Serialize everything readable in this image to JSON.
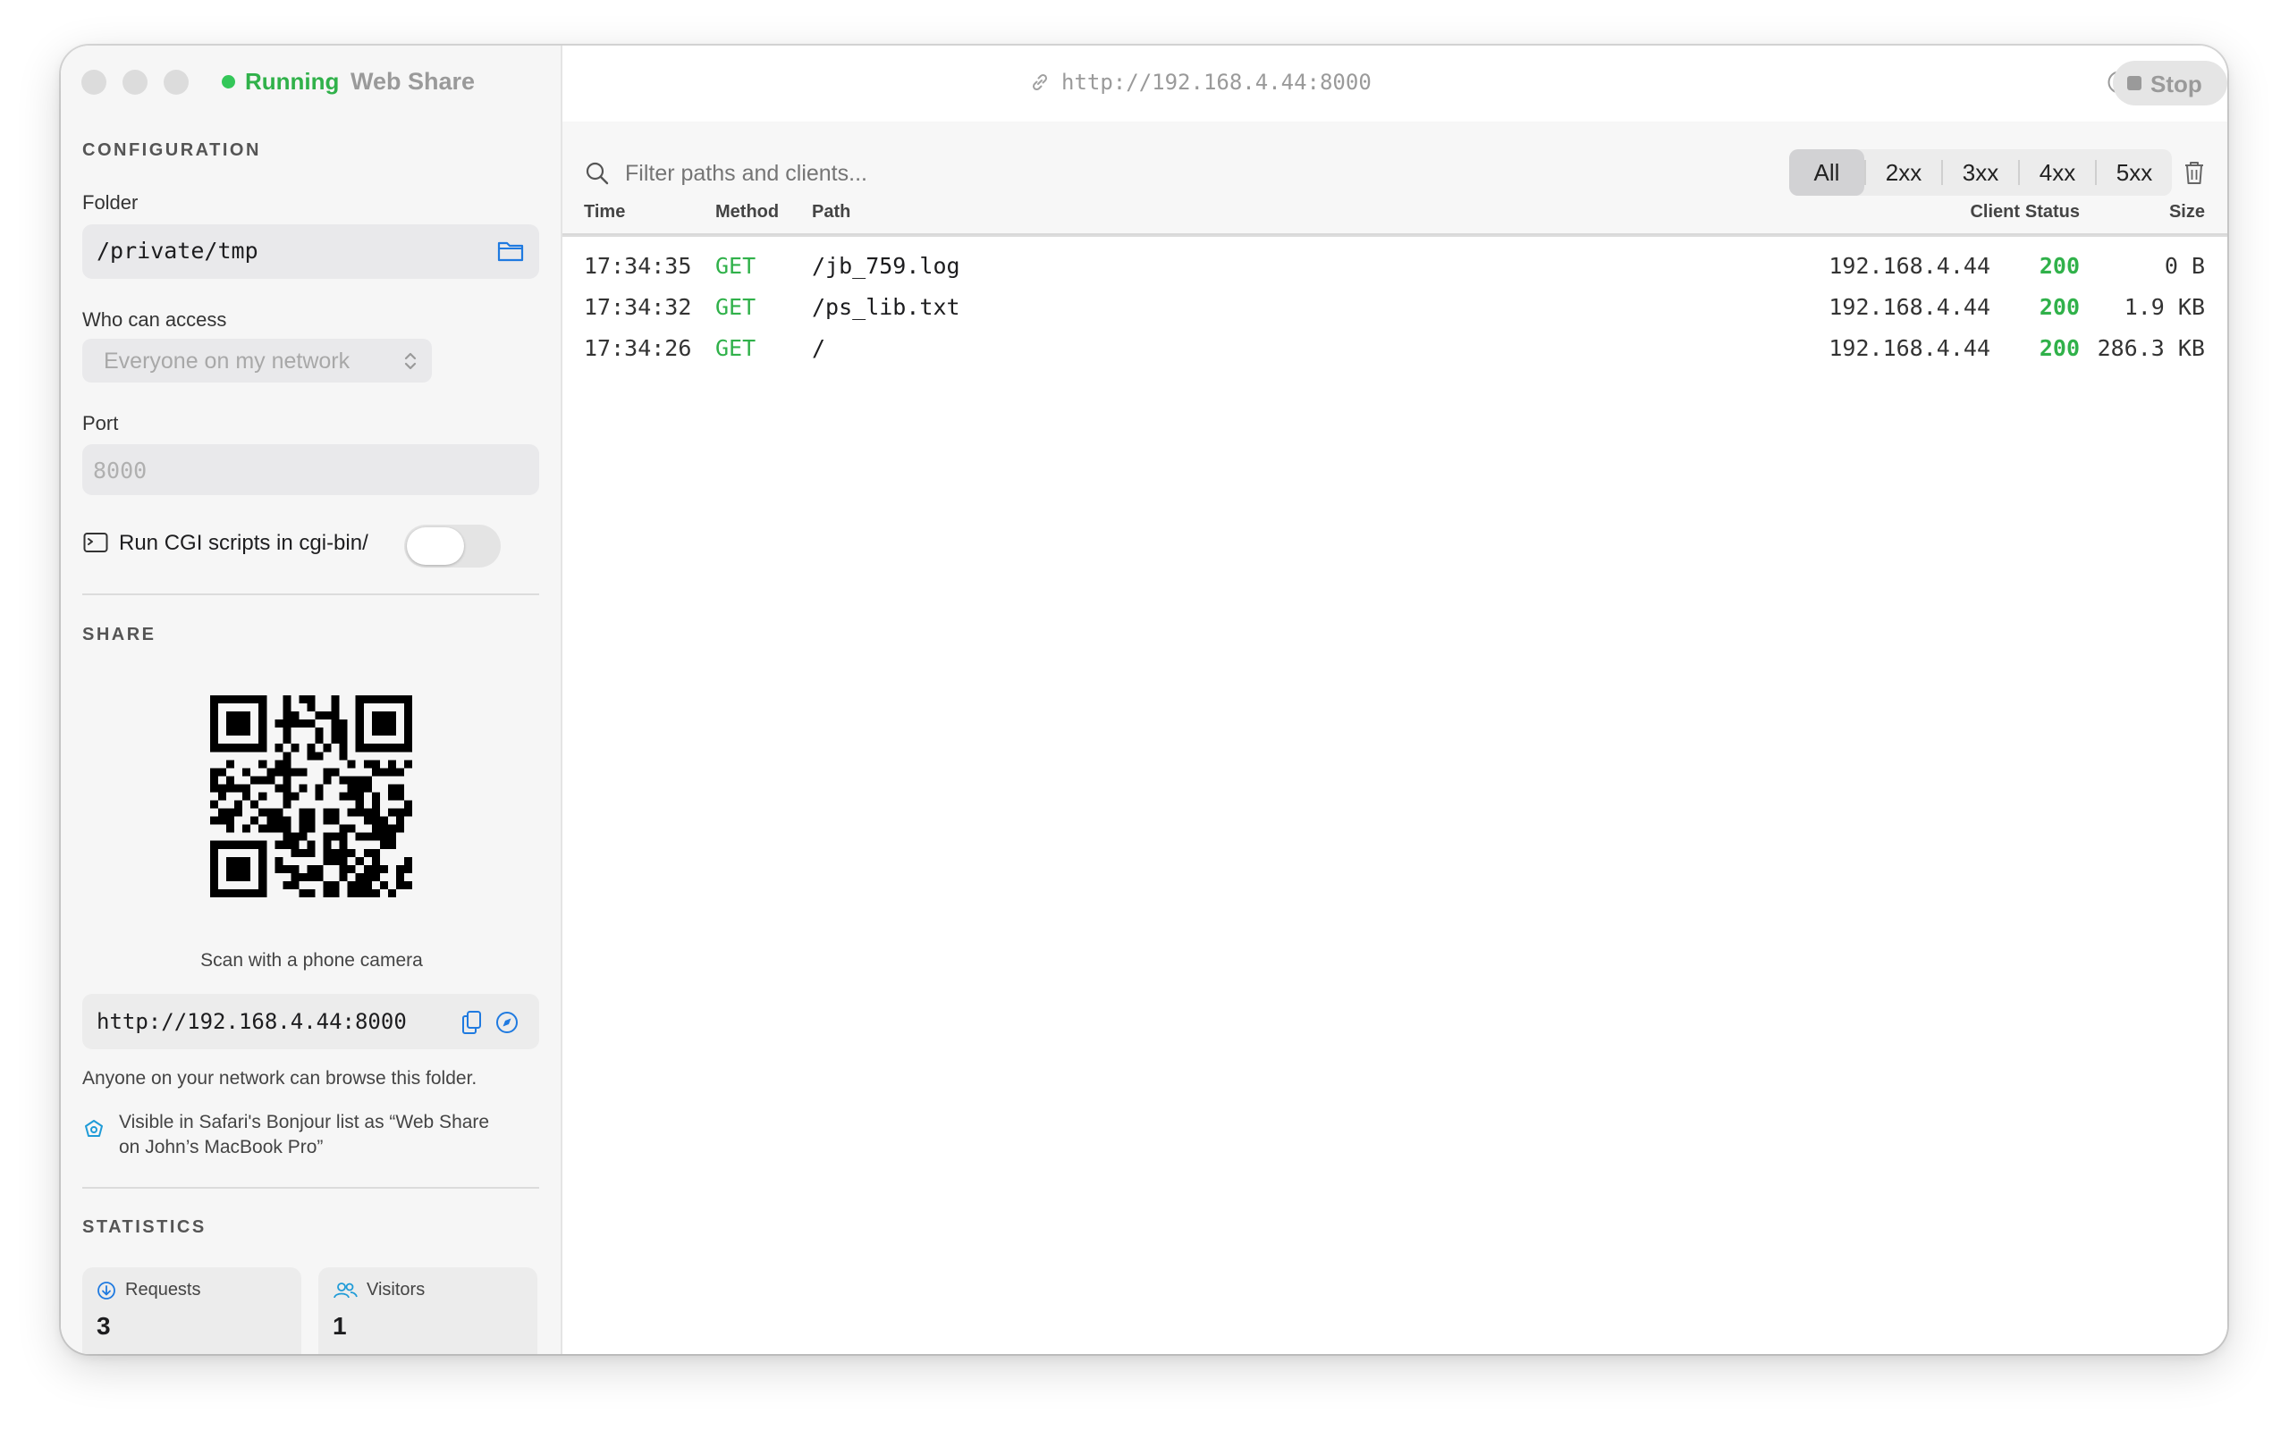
{
  "window": {
    "status": "Running",
    "title": "Web Share"
  },
  "config": {
    "heading": "CONFIGURATION",
    "folder_label": "Folder",
    "folder_value": "/private/tmp",
    "access_label": "Who can access",
    "access_value": "Everyone on my network",
    "port_label": "Port",
    "port_placeholder": "8000",
    "cgi_label": "Run CGI scripts in cgi-bin/",
    "cgi_enabled": false
  },
  "share": {
    "heading": "SHARE",
    "qr_caption": "Scan with a phone camera",
    "url": "http://192.168.4.44:8000",
    "note": "Anyone on your network can browse this folder.",
    "bonjour_line1": "Visible in Safari's Bonjour list as “Web Share",
    "bonjour_line2": "on John’s MacBook Pro”"
  },
  "stats": {
    "heading": "STATISTICS",
    "requests_label": "Requests",
    "requests_value": "3",
    "visitors_label": "Visitors",
    "visitors_value": "1"
  },
  "toolbar": {
    "url": "http://192.168.4.44:8000",
    "stop_label": "Stop"
  },
  "filter": {
    "placeholder": "Filter paths and clients...",
    "options": [
      "All",
      "2xx",
      "3xx",
      "4xx",
      "5xx"
    ],
    "selected": "All"
  },
  "table": {
    "headers": {
      "time": "Time",
      "method": "Method",
      "path": "Path",
      "client": "Client",
      "status": "Status",
      "size": "Size"
    },
    "rows": [
      {
        "time": "17:34:35",
        "method": "GET",
        "path": "/jb_759.log",
        "client": "192.168.4.44",
        "status": "200",
        "size": "0 B"
      },
      {
        "time": "17:34:32",
        "method": "GET",
        "path": "/ps_lib.txt",
        "client": "192.168.4.44",
        "status": "200",
        "size": "1.9 KB"
      },
      {
        "time": "17:34:26",
        "method": "GET",
        "path": "/",
        "client": "192.168.4.44",
        "status": "200",
        "size": "286.3 KB"
      }
    ]
  },
  "colors": {
    "accent": "#1f7ae0",
    "success": "#30b14a",
    "running_dot": "#34c759"
  }
}
